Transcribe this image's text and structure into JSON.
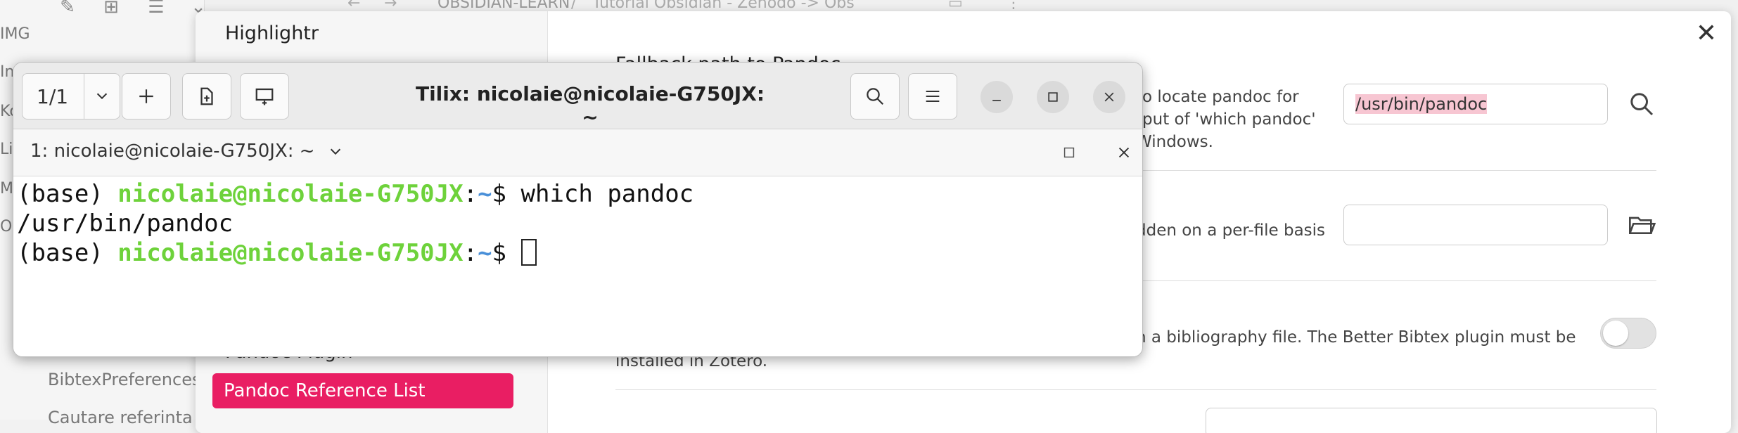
{
  "obsidian": {
    "vault_name": "OBSIDIAN-LEARN",
    "breadcrumb_separator": "/",
    "breadcrumb_current": "Tutorial Obsidian - Zenodo -> Obs",
    "sidebar_clipped": [
      "IMG",
      "In",
      "Ko",
      "Li",
      "M",
      "O"
    ],
    "sidebar_items": [
      "BibtexPreferences",
      "Cautare referinta"
    ]
  },
  "settings": {
    "title": "Highlightr",
    "nav_items": [
      "Pandoc Plugin"
    ],
    "nav_active": "Pandoc Reference List",
    "section_heading": "Fallback path to Pandoc",
    "row1_desc": [
      "to locate pandoc for",
      "tput of 'which pandoc'",
      "Windows."
    ],
    "row1_value": "/usr/bin/pandoc",
    "row2_desc": "dden on a per-file basis",
    "row2_value": "",
    "row3_desc": [
      "n a bibliography file. The Better Bibtex plugin must be",
      "installed in Zotero."
    ],
    "toggle_on": false
  },
  "tilix": {
    "session_label": "1/1",
    "title": "Tilix: nicolaie@nicolaie-G750JX: ~",
    "tab_title": "1: nicolaie@nicolaie-G750JX: ~",
    "terminal": {
      "env_prefix": "(base) ",
      "user_host": "nicolaie@nicolaie-G750JX",
      "colon": ":",
      "cwd": "~",
      "prompt_symbol": "$ ",
      "command": "which pandoc",
      "output": "/usr/bin/pandoc"
    }
  },
  "colors": {
    "accent_pink": "#e91e63",
    "prompt_green": "#6ed23b",
    "prompt_blue": "#4a90d9"
  }
}
